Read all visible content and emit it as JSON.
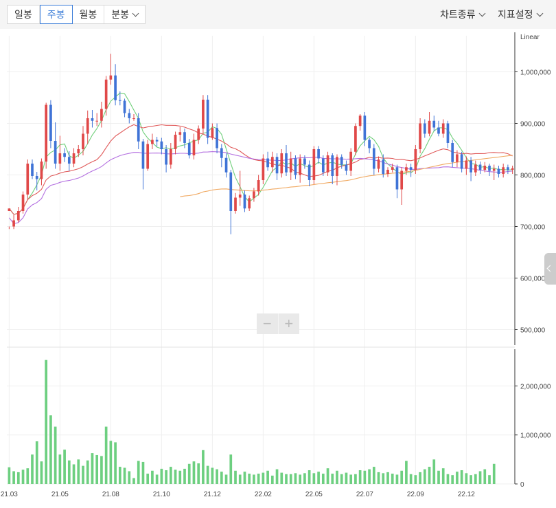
{
  "toolbar": {
    "tabs": [
      {
        "label": "일봉"
      },
      {
        "label": "주봉",
        "active": true
      },
      {
        "label": "월봉"
      },
      {
        "label": "분봉",
        "dropdown": true
      }
    ],
    "chart_type_label": "차트종류",
    "indicator_label": "지표설정"
  },
  "zoom": {
    "minus": "−",
    "plus": "+"
  },
  "chart_data": {
    "type": "candlestick",
    "scale_label": "Linear",
    "price_axis": {
      "ticks": [
        "1,000,000",
        "900,000",
        "800,000",
        "700,000",
        "600,000",
        "500,000"
      ],
      "values": [
        1000000,
        900000,
        800000,
        700000,
        600000,
        500000
      ],
      "range": [
        470000,
        1070000
      ]
    },
    "volume_axis": {
      "ticks": [
        "2,000,000",
        "1,000,000",
        "0"
      ],
      "values": [
        2000000,
        1000000,
        0
      ],
      "range": [
        0,
        2750000
      ]
    },
    "x_ticks": [
      {
        "label": "21.03",
        "i": 0
      },
      {
        "label": "21.05",
        "i": 11
      },
      {
        "label": "21.08",
        "i": 22
      },
      {
        "label": "21.10",
        "i": 33
      },
      {
        "label": "21.12",
        "i": 44
      },
      {
        "label": "22.02",
        "i": 55
      },
      {
        "label": "22.05",
        "i": 66
      },
      {
        "label": "22.07",
        "i": 77
      },
      {
        "label": "22.09",
        "i": 88
      },
      {
        "label": "22.12",
        "i": 99
      }
    ],
    "colors": {
      "up": "#e04848",
      "down": "#3f73d6",
      "volume": "#6dcf80",
      "ma5": "#6fcf7a",
      "ma20": "#e05a5a",
      "ma60": "#b36fe0",
      "ma120": "#f0a860",
      "grid": "#efefef",
      "axis": "#333333"
    },
    "candles": [
      [
        730000,
        735000,
        700000,
        695000
      ],
      [
        700000,
        712000,
        695000,
        722000
      ],
      [
        712000,
        730000,
        708000,
        738000
      ],
      [
        730000,
        762000,
        725000,
        768000
      ],
      [
        762000,
        822000,
        752000,
        830000
      ],
      [
        822000,
        798000,
        792000,
        830000
      ],
      [
        798000,
        792000,
        770000,
        806000
      ],
      [
        792000,
        826000,
        780000,
        832000
      ],
      [
        826000,
        936000,
        812000,
        940000
      ],
      [
        936000,
        866000,
        852000,
        945000
      ],
      [
        866000,
        822000,
        812000,
        902000
      ],
      [
        822000,
        842000,
        808000,
        876000
      ],
      [
        842000,
        835000,
        825000,
        852000
      ],
      [
        835000,
        822000,
        808000,
        846000
      ],
      [
        822000,
        842000,
        815000,
        852000
      ],
      [
        842000,
        850000,
        835000,
        858000
      ],
      [
        850000,
        880000,
        838000,
        895000
      ],
      [
        880000,
        910000,
        860000,
        925000
      ],
      [
        910000,
        905000,
        892000,
        926000
      ],
      [
        905000,
        905000,
        895000,
        920000
      ],
      [
        905000,
        928000,
        892000,
        942000
      ],
      [
        928000,
        985000,
        915000,
        992000
      ],
      [
        985000,
        993000,
        975000,
        1035000
      ],
      [
        993000,
        945000,
        935000,
        1015000
      ],
      [
        945000,
        944000,
        935000,
        962000
      ],
      [
        944000,
        920000,
        912000,
        948000
      ],
      [
        920000,
        910000,
        900000,
        928000
      ],
      [
        910000,
        910000,
        905000,
        918000
      ],
      [
        910000,
        865000,
        850000,
        920000
      ],
      [
        865000,
        812000,
        772000,
        870000
      ],
      [
        812000,
        860000,
        808000,
        868000
      ],
      [
        860000,
        868000,
        850000,
        880000
      ],
      [
        868000,
        865000,
        855000,
        874000
      ],
      [
        865000,
        850000,
        840000,
        872000
      ],
      [
        850000,
        820000,
        805000,
        858000
      ],
      [
        820000,
        850000,
        812000,
        862000
      ],
      [
        850000,
        878000,
        840000,
        884000
      ],
      [
        878000,
        883000,
        865000,
        893000
      ],
      [
        883000,
        862000,
        852000,
        890000
      ],
      [
        862000,
        838000,
        832000,
        870000
      ],
      [
        838000,
        868000,
        830000,
        880000
      ],
      [
        868000,
        890000,
        860000,
        896000
      ],
      [
        890000,
        946000,
        880000,
        955000
      ],
      [
        946000,
        872000,
        860000,
        955000
      ],
      [
        872000,
        891000,
        868000,
        900000
      ],
      [
        891000,
        852000,
        842000,
        900000
      ],
      [
        852000,
        833000,
        815000,
        860000
      ],
      [
        833000,
        805000,
        795000,
        842000
      ],
      [
        805000,
        730000,
        685000,
        810000
      ],
      [
        730000,
        756000,
        725000,
        765000
      ],
      [
        756000,
        762000,
        740000,
        808000
      ],
      [
        762000,
        735000,
        728000,
        770000
      ],
      [
        735000,
        755000,
        730000,
        760000
      ],
      [
        755000,
        768000,
        748000,
        775000
      ],
      [
        768000,
        790000,
        760000,
        800000
      ],
      [
        790000,
        832000,
        782000,
        840000
      ],
      [
        832000,
        815000,
        808000,
        845000
      ],
      [
        815000,
        835000,
        805000,
        845000
      ],
      [
        835000,
        803000,
        790000,
        842000
      ],
      [
        803000,
        842000,
        795000,
        850000
      ],
      [
        842000,
        805000,
        798000,
        858000
      ],
      [
        805000,
        832000,
        790000,
        845000
      ],
      [
        832000,
        800000,
        792000,
        838000
      ],
      [
        800000,
        832000,
        785000,
        840000
      ],
      [
        832000,
        820000,
        812000,
        838000
      ],
      [
        820000,
        790000,
        778000,
        828000
      ],
      [
        790000,
        850000,
        782000,
        856000
      ],
      [
        850000,
        832000,
        822000,
        856000
      ],
      [
        832000,
        805000,
        798000,
        838000
      ],
      [
        805000,
        838000,
        798000,
        845000
      ],
      [
        838000,
        798000,
        782000,
        842000
      ],
      [
        798000,
        835000,
        780000,
        840000
      ],
      [
        835000,
        820000,
        812000,
        840000
      ],
      [
        820000,
        808000,
        800000,
        828000
      ],
      [
        808000,
        845000,
        798000,
        852000
      ],
      [
        845000,
        895000,
        838000,
        900000
      ],
      [
        895000,
        915000,
        886000,
        918000
      ],
      [
        915000,
        868000,
        856000,
        922000
      ],
      [
        868000,
        852000,
        842000,
        872000
      ],
      [
        852000,
        812000,
        800000,
        860000
      ],
      [
        812000,
        830000,
        805000,
        836000
      ],
      [
        830000,
        802000,
        795000,
        840000
      ],
      [
        802000,
        810000,
        796000,
        815000
      ],
      [
        810000,
        815000,
        805000,
        822000
      ],
      [
        815000,
        772000,
        755000,
        820000
      ],
      [
        772000,
        808000,
        742000,
        815000
      ],
      [
        808000,
        815000,
        800000,
        822000
      ],
      [
        815000,
        810000,
        796000,
        822000
      ],
      [
        810000,
        850000,
        802000,
        858000
      ],
      [
        850000,
        900000,
        842000,
        910000
      ],
      [
        900000,
        880000,
        872000,
        908000
      ],
      [
        880000,
        905000,
        875000,
        922000
      ],
      [
        905000,
        892000,
        885000,
        915000
      ],
      [
        892000,
        880000,
        875000,
        905000
      ],
      [
        880000,
        900000,
        872000,
        908000
      ],
      [
        900000,
        862000,
        852000,
        905000
      ],
      [
        862000,
        825000,
        815000,
        868000
      ],
      [
        825000,
        840000,
        815000,
        848000
      ],
      [
        840000,
        812000,
        805000,
        845000
      ],
      [
        812000,
        828000,
        800000,
        836000
      ],
      [
        828000,
        805000,
        788000,
        835000
      ],
      [
        805000,
        820000,
        798000,
        828000
      ],
      [
        820000,
        810000,
        802000,
        826000
      ],
      [
        810000,
        818000,
        805000,
        825000
      ],
      [
        818000,
        808000,
        798000,
        822000
      ],
      [
        808000,
        812000,
        790000,
        820000
      ],
      [
        812000,
        802000,
        795000,
        818000
      ],
      [
        802000,
        815000,
        795000,
        822000
      ],
      [
        815000,
        810000,
        802000,
        820000
      ],
      [
        810000,
        813000,
        802000,
        818000
      ]
    ],
    "volume": [
      340000,
      260000,
      240000,
      290000,
      320000,
      600000,
      870000,
      460000,
      2530000,
      1400000,
      1170000,
      600000,
      700000,
      480000,
      400000,
      500000,
      370000,
      480000,
      630000,
      590000,
      570000,
      1170000,
      880000,
      850000,
      350000,
      330000,
      260000,
      120000,
      470000,
      450000,
      210000,
      270000,
      190000,
      310000,
      280000,
      350000,
      290000,
      270000,
      310000,
      410000,
      460000,
      420000,
      690000,
      370000,
      330000,
      300000,
      250000,
      190000,
      600000,
      270000,
      190000,
      250000,
      210000,
      190000,
      210000,
      230000,
      270000,
      170000,
      300000,
      230000,
      200000,
      200000,
      220000,
      190000,
      220000,
      280000,
      220000,
      250000,
      210000,
      320000,
      210000,
      270000,
      200000,
      230000,
      190000,
      200000,
      280000,
      270000,
      300000,
      350000,
      240000,
      220000,
      240000,
      210000,
      190000,
      270000,
      470000,
      200000,
      180000,
      240000,
      300000,
      350000,
      500000,
      270000,
      320000,
      200000,
      180000,
      250000,
      280000,
      220000,
      180000,
      200000,
      260000,
      300000,
      180000,
      410000
    ],
    "moving_averages": [
      {
        "period": 5,
        "color": "#6fcf7a"
      },
      {
        "period": 20,
        "color": "#e05a5a"
      },
      {
        "period": 60,
        "color": "#b36fe0"
      },
      {
        "period": 120,
        "color": "#f0a860"
      }
    ]
  }
}
